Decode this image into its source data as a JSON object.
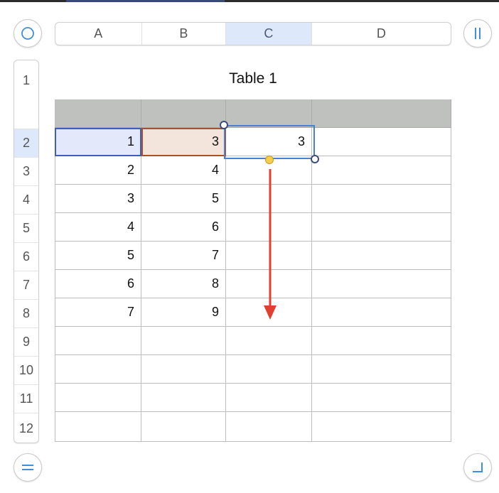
{
  "columns": [
    {
      "label": "A",
      "selected": false
    },
    {
      "label": "B",
      "selected": false
    },
    {
      "label": "C",
      "selected": true
    },
    {
      "label": "D",
      "selected": false
    }
  ],
  "rows": [
    "1",
    "2",
    "3",
    "4",
    "5",
    "6",
    "7",
    "8",
    "9",
    "10",
    "11",
    "12"
  ],
  "selected_row": "2",
  "table": {
    "title": "Table 1",
    "col_a": [
      "",
      "1",
      "2",
      "3",
      "4",
      "5",
      "6",
      "7",
      "",
      "",
      "",
      ""
    ],
    "col_b": [
      "",
      "3",
      "4",
      "5",
      "6",
      "7",
      "8",
      "9",
      "",
      "",
      "",
      ""
    ],
    "col_c": [
      "",
      "3",
      "",
      "",
      "",
      "",
      "",
      "",
      "",
      "",
      "",
      ""
    ],
    "col_d": [
      "",
      "",
      "",
      "",
      "",
      "",
      "",
      "",
      "",
      "",
      "",
      ""
    ]
  },
  "icons": {
    "table_select": "circle-select-icon",
    "column_handle": "column-handle-icon",
    "row_handle": "row-handle-icon",
    "resize": "resize-corner-icon",
    "fill_arrow": "down-arrow-icon"
  },
  "colors": {
    "header_row": "#bfc1bf",
    "selection_blue": "#4a7fd6",
    "arrow_red": "#e04030",
    "fill_handle": "#f5cc4c",
    "cell_a_highlight": "#e3e8fb",
    "cell_b_highlight": "#f3e4dc"
  }
}
